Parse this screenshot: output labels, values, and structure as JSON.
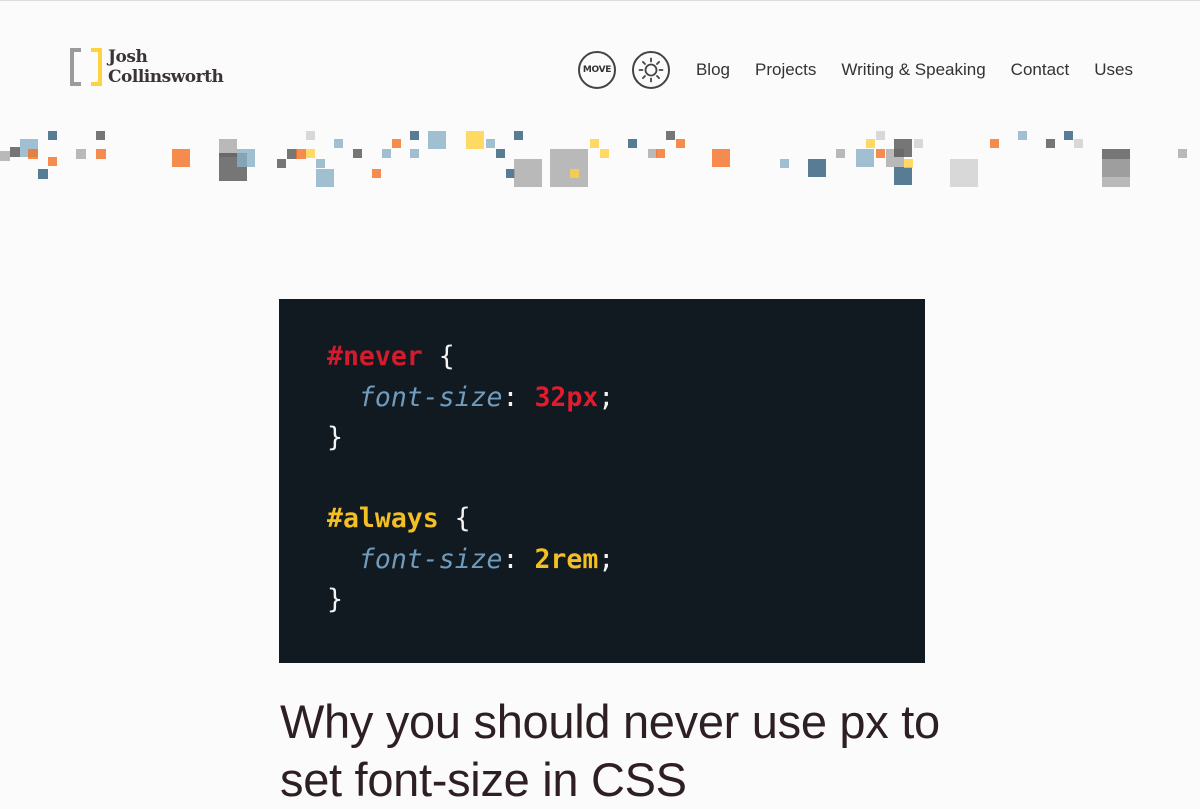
{
  "site": {
    "logo_line1": "Josh",
    "logo_line2": "Collinsworth"
  },
  "nav": {
    "move_label": "MOVE",
    "theme_icon": "sun-icon",
    "links": [
      "Blog",
      "Projects",
      "Writing & Speaking",
      "Contact",
      "Uses"
    ]
  },
  "decoration": {
    "palette": [
      "#2e5d7a",
      "#f46f22",
      "#ffd23f",
      "#8ab1c8",
      "#555555",
      "#a9a9a9",
      "#cfcfcf"
    ]
  },
  "code": {
    "sel1": "#never",
    "prop1": "font-size",
    "val1": "32px",
    "sel2": "#always",
    "prop2": "font-size",
    "val2": "2rem",
    "open": "{",
    "close": "}",
    "colon": ":",
    "semi": ";",
    "colors": {
      "background": "#111921",
      "red": "#e31b2e",
      "yellow": "#f4bf24",
      "property": "#6f9bbd"
    }
  },
  "article": {
    "title": "Why you should never use px to set font-size in CSS"
  }
}
